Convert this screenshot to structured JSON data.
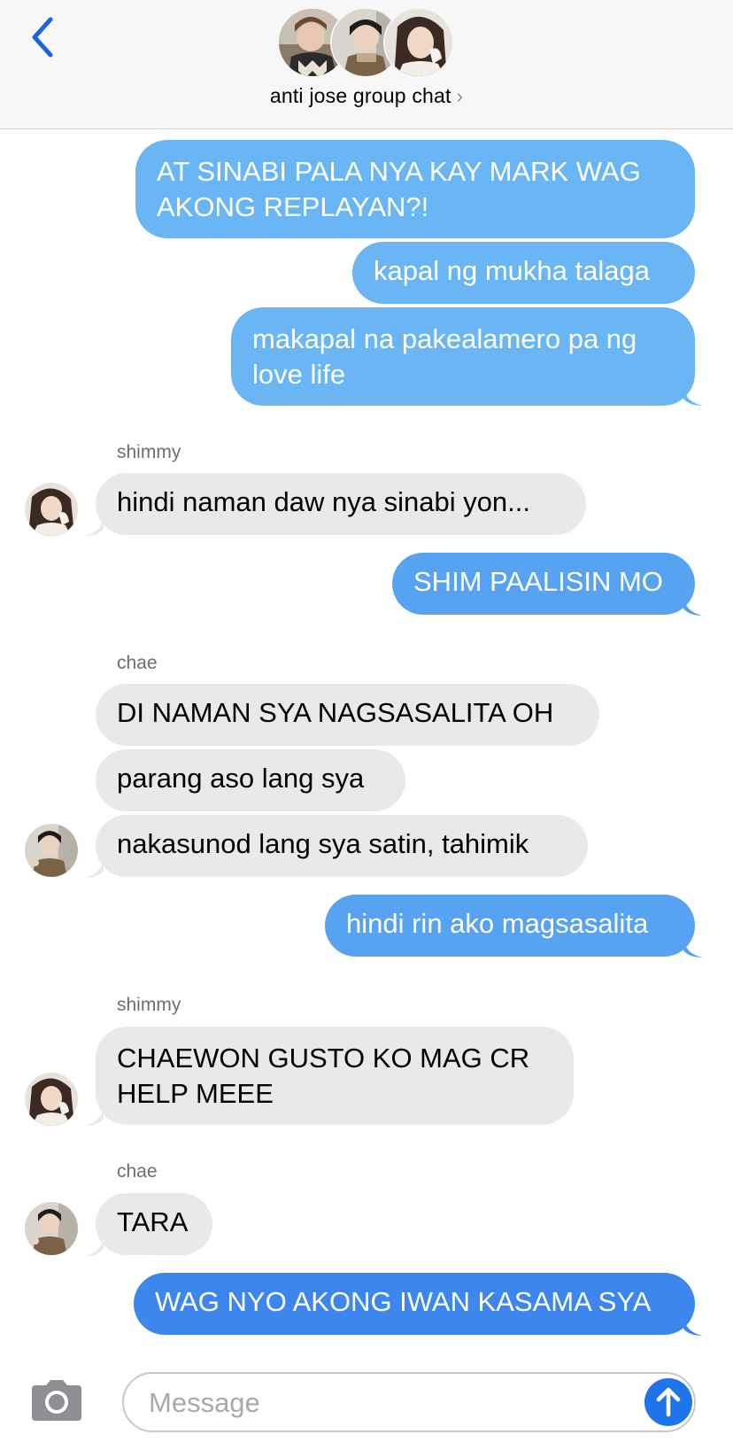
{
  "header": {
    "title": "anti jose group chat",
    "chevron": "›",
    "back_icon": "chevron-left-icon",
    "accent": "#1a63e0"
  },
  "messages": [
    {
      "from": "me",
      "text": "AT SINABI PALA NYA KAY MARK WAG AKONG REPLAYAN?!"
    },
    {
      "from": "me",
      "text": "kapal ng mukha talaga"
    },
    {
      "from": "me",
      "text": "makapal na pakealamero pa ng love life"
    },
    {
      "from": "shimmy",
      "sender": "shimmy",
      "text": "hindi naman daw nya sinabi yon..."
    },
    {
      "from": "me",
      "text": "SHIM PAALISIN MO"
    },
    {
      "from": "chae",
      "sender": "chae",
      "text": "DI NAMAN SYA NAGSASALITA OH"
    },
    {
      "from": "chae",
      "text": "parang aso lang sya"
    },
    {
      "from": "chae",
      "text": "nakasunod lang sya satin, tahimik"
    },
    {
      "from": "me",
      "text": "hindi rin ako magsasalita"
    },
    {
      "from": "shimmy",
      "sender": "shimmy",
      "text": "CHAEWON GUSTO KO MAG CR HELP MEEE"
    },
    {
      "from": "chae",
      "sender": "chae",
      "text": "TARA"
    },
    {
      "from": "me",
      "text": "WAG NYO AKONG IWAN KASAMA SYA"
    }
  ],
  "composer": {
    "placeholder": "Message",
    "camera_icon": "camera-icon",
    "send_icon": "arrow-up-icon"
  },
  "colors": {
    "bubble_out_light": "#6ab6f4",
    "bubble_out_mid": "#57a2f1",
    "bubble_out_deep": "#3d86ee",
    "bubble_in": "#e9e9eb"
  }
}
